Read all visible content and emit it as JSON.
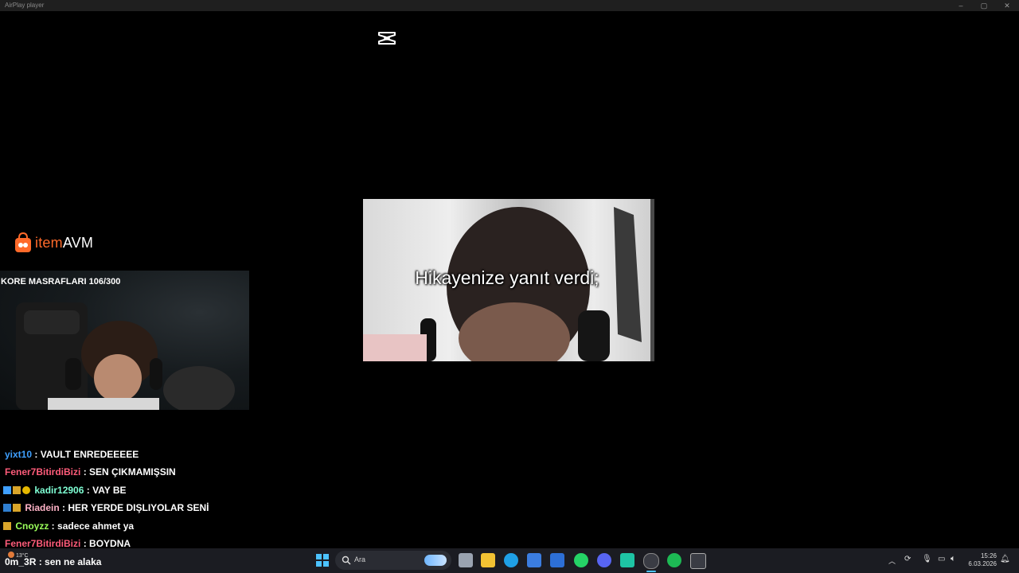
{
  "window": {
    "title": "AirPlay player"
  },
  "brand": {
    "prefix": "item",
    "suffix": "AVM"
  },
  "webcam": {
    "overlay_text": "KORE MASRAFLARI 106/300"
  },
  "story": {
    "caption": "Hikayenize yanıt verdi;"
  },
  "chat": {
    "messages": [
      {
        "user": "yixt10",
        "user_color": "#3fa0ff",
        "message": "VAULT ENREDEEEEE"
      },
      {
        "user": "Fener7BitirdiBizi",
        "user_color": "#ff5c7a",
        "message": "SEN ÇIKMAMIŞSIN"
      },
      {
        "user": "kadir12906",
        "user_color": "#7fffd4",
        "message": "VAY BE"
      },
      {
        "user": "Riadein",
        "user_color": "#ffb3c7",
        "message": "HER YERDE DIŞLIYOLAR SENİ"
      },
      {
        "user": "Cnoyzz",
        "user_color": "#9aff5a",
        "message": "sadece ahmet ya"
      },
      {
        "user": "Fener7BitirdiBizi",
        "user_color": "#ff5c7a",
        "message": "BOYDNA"
      },
      {
        "user": "0m_3R",
        "user_color": "#ffffff",
        "message": "sen ne alaka"
      }
    ]
  },
  "taskbar": {
    "weather": "13°C",
    "search_placeholder": "Ara",
    "time": "15:26",
    "date": "6.03.2026"
  },
  "colors": {
    "accent": "#ff6a2a",
    "taskbar_bg": "#1b1c22"
  }
}
